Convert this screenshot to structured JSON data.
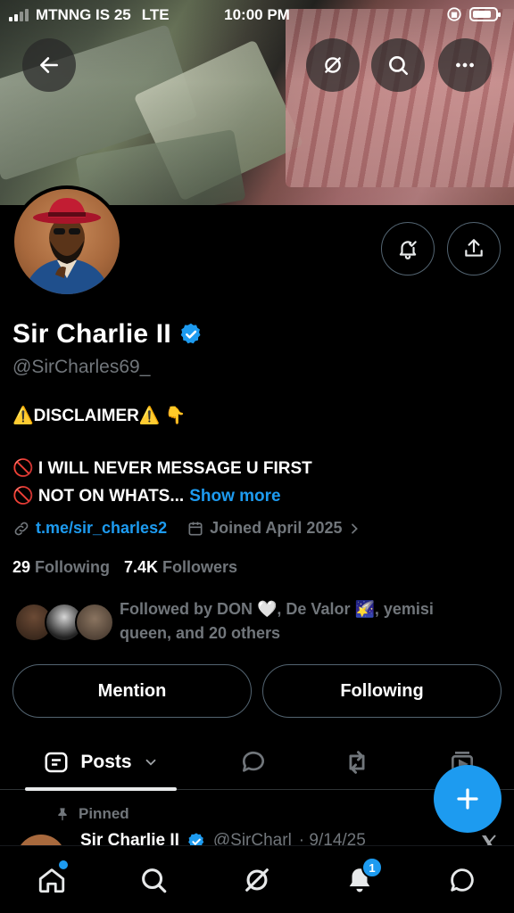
{
  "status_bar": {
    "carrier": "MTNNG IS 25",
    "network": "LTE",
    "time": "10:00 PM",
    "battery_level": 0.85
  },
  "header": {
    "back_icon": "arrow-left-icon",
    "grok_icon": "grok-icon",
    "search_icon": "search-icon",
    "more_icon": "ellipsis-icon"
  },
  "profile": {
    "name": "Sir Charlie II",
    "verified": true,
    "handle": "@SirCharles69_",
    "bio": {
      "line1": "⚠️DISCLAIMER⚠️ 👇",
      "line2": "🚫 I WILL NEVER MESSAGE U FIRST",
      "line3": "🚫 NOT ON WHATS...",
      "show_more": "Show more"
    },
    "link": "t.me/sir_charles2",
    "joined": "Joined April 2025",
    "following_count": "29",
    "following_label": "Following",
    "followers_count": "7.4K",
    "followers_label": "Followers",
    "followed_by_line1": "Followed by DON 🤍, De Valor 🌠, yemisi",
    "followed_by_line2": "queen, and 20 others"
  },
  "actions": {
    "mention": "Mention",
    "following": "Following"
  },
  "tabs": {
    "posts": "Posts"
  },
  "pinned_post": {
    "pinned_label": "Pinned",
    "author": "Sir Charlie II",
    "handle": "@SirCharl",
    "date": "· 9/14/25"
  },
  "bottom_nav": {
    "notifications_badge": "1"
  },
  "colors": {
    "accent": "#1d9bf0",
    "background": "#000000",
    "muted": "#71767b",
    "border": "#536471"
  }
}
